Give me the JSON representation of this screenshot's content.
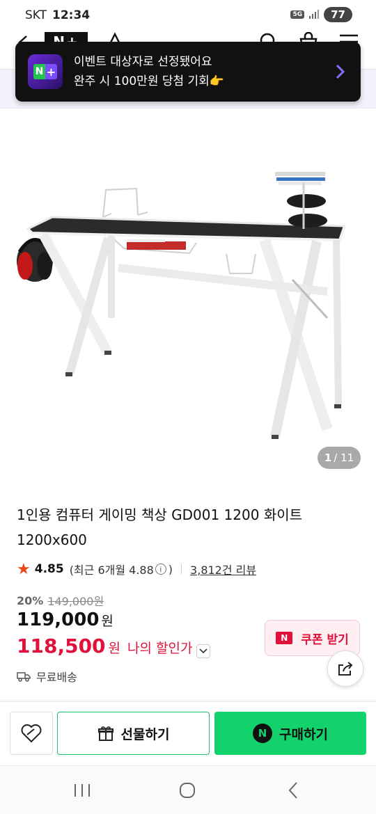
{
  "status_bar": {
    "carrier": "SKT",
    "time": "12:34",
    "network": "5G",
    "battery": "77"
  },
  "toast": {
    "line1": "이벤트 대상자로 선정됐어요",
    "line2": "완주 시 100만원 당첨 기회👉"
  },
  "header": {
    "logo": "N+"
  },
  "pager": {
    "current": "1",
    "total": "/ 11"
  },
  "product": {
    "title": "1인용 컴퓨터 게이밍 책상 GD001 1200 화이트 1200x600",
    "rating": "4.85",
    "rating_recent": "(최근 6개월 4.88",
    "rating_close": ")",
    "reviews": "3,812건 리뷰",
    "discount_rate": "20%",
    "original_price": "149,000원",
    "price": "119,000",
    "price_unit": "원",
    "my_price": "118,500",
    "my_price_unit": "원",
    "my_price_label": "나의 할인가",
    "shipping": "무료배송"
  },
  "coupon": {
    "badge": "N",
    "label": "쿠폰 받기"
  },
  "actions": {
    "gift_label": "선물하기",
    "buy_badge": "N",
    "buy_label": "구매하기"
  },
  "colors": {
    "accent_red": "#e0113b",
    "naver_green": "#13d26b",
    "toast_bg": "#111111"
  }
}
